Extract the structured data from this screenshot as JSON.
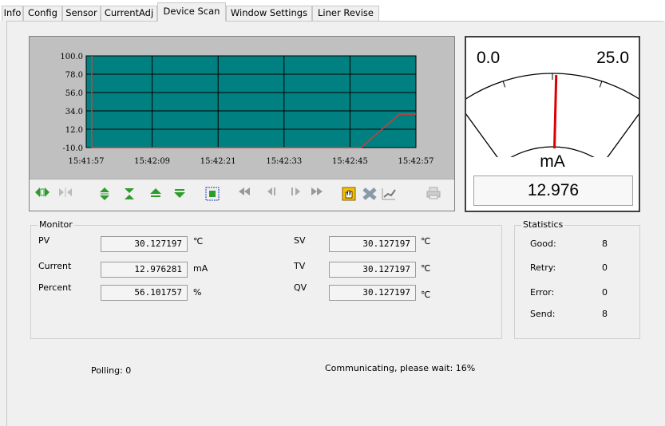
{
  "tabs": [
    "Info",
    "Config",
    "Sensor",
    "CurrentAdj",
    "Device Scan",
    "Window Settings",
    "Liner Revise"
  ],
  "active_tab": "Device Scan",
  "trend": {
    "y_ticks": [
      "100.0",
      "78.0",
      "56.0",
      "34.0",
      "12.0",
      "-10.0"
    ],
    "x_ticks": [
      "15:41:57",
      "15:42:09",
      "15:42:21",
      "15:42:33",
      "15:42:45",
      "15:42:57"
    ],
    "colors": {
      "plot_bg": "#008080",
      "grid": "#000000",
      "trace": "#c04040"
    },
    "trace_points": [
      {
        "x": "15:41:58",
        "y": 100.0
      },
      {
        "x": "15:41:58",
        "y": -10.0
      },
      {
        "x": "15:42:47",
        "y": -10.0
      },
      {
        "x": "15:42:54",
        "y": 30.1
      },
      {
        "x": "15:42:57",
        "y": 30.1
      }
    ]
  },
  "toolbar": {
    "icons": [
      "scroll-left-right-icon",
      "scroll-reset-icon",
      "zoom-y-in-icon",
      "zoom-y-out-icon",
      "scroll-y-up-icon",
      "scroll-y-down-icon",
      "fit-all-icon",
      "page-back-icon",
      "step-back-icon",
      "step-forward-icon",
      "page-forward-icon",
      "hand-pan-icon",
      "delete-cursor-icon",
      "chart-line-icon",
      "print-icon"
    ]
  },
  "gauge": {
    "min_label": "0.0",
    "max_label": "25.0",
    "unit": "mA",
    "value": "12.976",
    "fraction": 0.519,
    "colors": {
      "needle": "#dd0000",
      "face": "#ffffff"
    }
  },
  "monitor": {
    "title": "Monitor",
    "left": [
      {
        "label": "PV",
        "value": "30.127197",
        "unit": "℃"
      },
      {
        "label": "Current",
        "value": "12.976281",
        "unit": "mA"
      },
      {
        "label": "Percent",
        "value": "56.101757",
        "unit": "%"
      }
    ],
    "right": [
      {
        "label": "SV",
        "value": "30.127197",
        "unit": "℃"
      },
      {
        "label": "TV",
        "value": "30.127197",
        "unit": "℃"
      },
      {
        "label": "QV",
        "value": "30.127197",
        "unit": "℃"
      }
    ]
  },
  "statistics": {
    "title": "Statistics",
    "rows": [
      {
        "label": "Good:",
        "value": "8"
      },
      {
        "label": "Retry:",
        "value": "0"
      },
      {
        "label": "Error:",
        "value": "0"
      },
      {
        "label": "Send:",
        "value": "8"
      }
    ]
  },
  "status": {
    "polling": "Polling: 0",
    "communicating": "Communicating, please wait:  16%"
  }
}
